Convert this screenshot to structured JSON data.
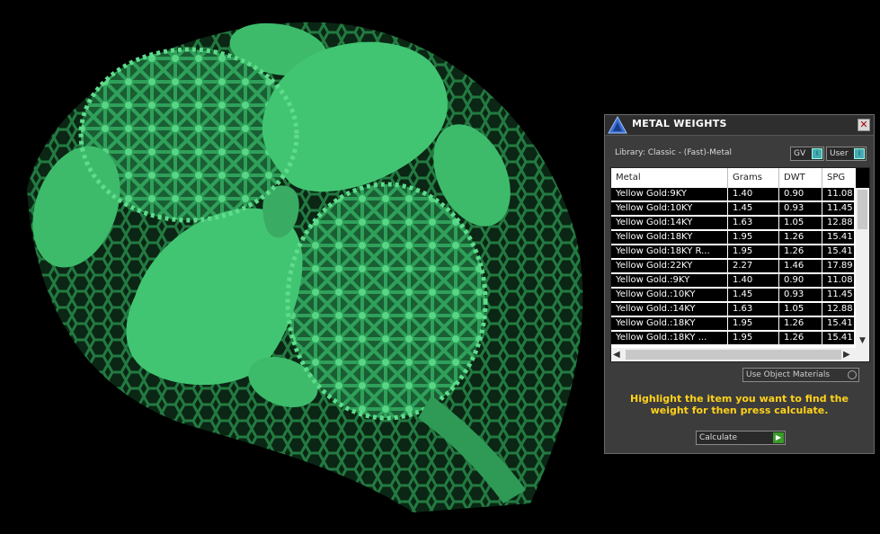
{
  "panel": {
    "title": "METAL WEIGHTS",
    "close_icon": "close-icon",
    "library_label": "Library: Classic - (Fast)-Metal",
    "unit_toggle": {
      "label": "GV",
      "icon": "info-icon"
    },
    "scope_toggle": {
      "label": "User",
      "icon": "info-icon"
    },
    "columns": [
      "Metal",
      "Grams",
      "DWT",
      "SPG"
    ],
    "rows": [
      [
        "Yellow Gold:9KY",
        "1.40",
        "0.90",
        "11.08"
      ],
      [
        "Yellow Gold:10KY",
        "1.45",
        "0.93",
        "11.45"
      ],
      [
        "Yellow Gold:14KY",
        "1.63",
        "1.05",
        "12.88"
      ],
      [
        "Yellow Gold:18KY",
        "1.95",
        "1.26",
        "15.41"
      ],
      [
        "Yellow Gold:18KY R...",
        "1.95",
        "1.26",
        "15.41"
      ],
      [
        "Yellow Gold:22KY",
        "2.27",
        "1.46",
        "17.89"
      ],
      [
        "Yellow Gold.:9KY",
        "1.40",
        "0.90",
        "11.08"
      ],
      [
        "Yellow Gold.:10KY",
        "1.45",
        "0.93",
        "11.45"
      ],
      [
        "Yellow Gold.:14KY",
        "1.63",
        "1.05",
        "12.88"
      ],
      [
        "Yellow Gold.:18KY",
        "1.95",
        "1.26",
        "15.41"
      ],
      [
        "Yellow Gold.:18KY ...",
        "1.95",
        "1.26",
        "15.41"
      ]
    ],
    "use_object_materials_label": "Use Object Materials",
    "instructions": "Highlight the item you want to find the weight for then press calculate.",
    "calculate_label": "Calculate"
  },
  "colors": {
    "model_green": "#3dbb6a",
    "instruction_yellow": "#ffd21a",
    "panel_bg": "#3c3c3c"
  }
}
